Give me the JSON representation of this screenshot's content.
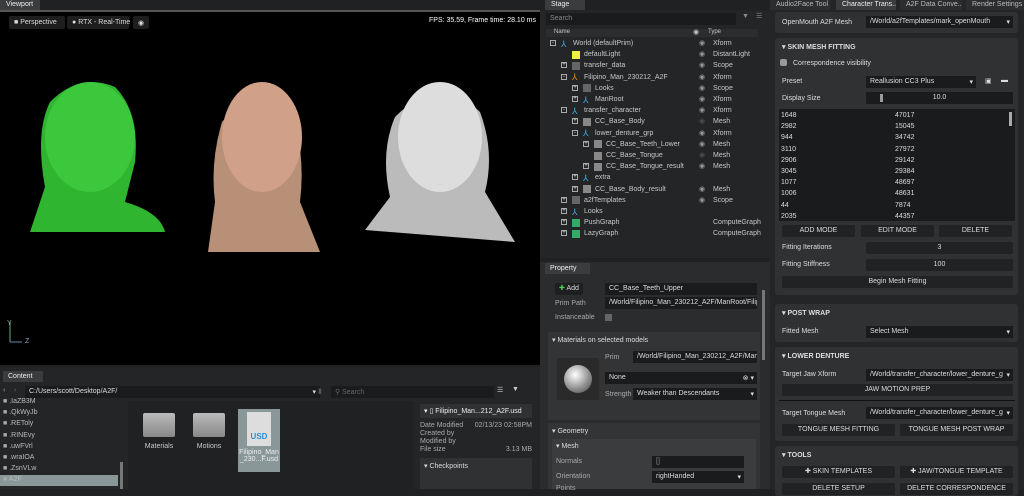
{
  "viewport": {
    "tab": "Viewport",
    "camera": "Perspective",
    "renderer": "RTX - Real-Time",
    "fps": "FPS: 35.59, Frame time: 28.10 ms",
    "axis_y": "Y",
    "axis_z": "Z"
  },
  "stage": {
    "tab": "Stage",
    "search_placeholder": "Search",
    "col_name": "Name",
    "col_type": "Type",
    "rows": [
      {
        "name": "World (defaultPrim)",
        "type": "Xform",
        "depth": 0,
        "exp": "-",
        "icon": "xform"
      },
      {
        "name": "defaultLight",
        "type": "DistantLight",
        "depth": 1,
        "exp": "",
        "icon": "light"
      },
      {
        "name": "transfer_data",
        "type": "Scope",
        "depth": 1,
        "exp": "+",
        "icon": "folder"
      },
      {
        "name": "Filipino_Man_230212_A2F",
        "type": "Xform",
        "depth": 1,
        "exp": "-",
        "icon": "xform-orange"
      },
      {
        "name": "Looks",
        "type": "Scope",
        "depth": 2,
        "exp": "+",
        "icon": "folder"
      },
      {
        "name": "ManRoot",
        "type": "Xform",
        "depth": 2,
        "exp": "+",
        "icon": "xform"
      },
      {
        "name": "transfer_character",
        "type": "Xform",
        "depth": 1,
        "exp": "-",
        "icon": "xform"
      },
      {
        "name": "CC_Base_Body",
        "type": "Mesh",
        "depth": 2,
        "exp": "+",
        "icon": "mesh"
      },
      {
        "name": "lower_denture_grp",
        "type": "Xform",
        "depth": 2,
        "exp": "-",
        "icon": "xform"
      },
      {
        "name": "CC_Base_Teeth_Lower",
        "type": "Mesh",
        "depth": 3,
        "exp": "+",
        "icon": "mesh"
      },
      {
        "name": "CC_Base_Tongue",
        "type": "Mesh",
        "depth": 3,
        "exp": "",
        "icon": "mesh"
      },
      {
        "name": "CC_Base_Tongue_result",
        "type": "Mesh",
        "depth": 3,
        "exp": "+",
        "icon": "mesh"
      },
      {
        "name": "extra",
        "type": "",
        "depth": 2,
        "exp": "+",
        "icon": "xform"
      },
      {
        "name": "CC_Base_Body_result",
        "type": "Mesh",
        "depth": 2,
        "exp": "+",
        "icon": "mesh"
      },
      {
        "name": "a2fTemplates",
        "type": "Scope",
        "depth": 1,
        "exp": "+",
        "icon": "folder"
      },
      {
        "name": "Looks",
        "type": "",
        "depth": 1,
        "exp": "+",
        "icon": "xform"
      },
      {
        "name": "PushGraph",
        "type": "ComputeGraph",
        "depth": 1,
        "exp": "+",
        "icon": "graph"
      },
      {
        "name": "LazyGraph",
        "type": "ComputeGraph",
        "depth": 1,
        "exp": "+",
        "icon": "graph"
      }
    ]
  },
  "property": {
    "tab": "Property",
    "add": "Add",
    "prim_name": "CC_Base_Teeth_Upper",
    "prim_path_label": "Prim Path",
    "prim_path": "/World/Filipino_Man_230212_A2F/ManRoot/Filipino",
    "instanceable_label": "Instanceable",
    "materials_header": "Materials on selected models",
    "prim_label": "Prim",
    "mat_prim": "/World/Filipino_Man_230212_A2F/ManRoot",
    "material": "None",
    "strength_label": "Strength",
    "strength": "Weaker than Descendants",
    "geometry_header": "Geometry",
    "mesh_header": "Mesh",
    "normals_label": "Normals",
    "normals": "[]",
    "orientation_label": "Orientation",
    "orientation": "rightHanded",
    "points_label": "Points"
  },
  "right": {
    "tabs": [
      "Audio2Face Tool",
      "Character Trans...",
      "A2F Data Conve...",
      "Render Settings"
    ],
    "openmouth_label": "OpenMouth A2F Mesh",
    "openmouth": "/World/a2fTemplates/mark_openMouth",
    "skin": {
      "header": "SKIN MESH FITTING",
      "corr": "Correspondence visibility",
      "preset_label": "Preset",
      "preset": "Reallusion CC3 Plus",
      "display_label": "Display Size",
      "display": "10.0",
      "pairs": [
        [
          "1648",
          "47017"
        ],
        [
          "2982",
          "15045"
        ],
        [
          "944",
          "34742"
        ],
        [
          "3110",
          "27972"
        ],
        [
          "2906",
          "29142"
        ],
        [
          "3045",
          "29384"
        ],
        [
          "1077",
          "48697"
        ],
        [
          "1006",
          "48631"
        ],
        [
          "44",
          "7874"
        ],
        [
          "2035",
          "44357"
        ]
      ],
      "add": "ADD MODE",
      "edit": "EDIT MODE",
      "delete": "DELETE",
      "iter_label": "Fitting Iterations",
      "iter": "3",
      "stiff_label": "Fitting Stiffness",
      "stiff": "100",
      "begin": "Begin Mesh Fitting"
    },
    "postwrap": {
      "header": "POST WRAP",
      "fitted_label": "Fitted Mesh",
      "fitted": "Select Mesh"
    },
    "denture": {
      "header": "LOWER DENTURE",
      "jaw_label": "Target Jaw Xform",
      "jaw": "/World/transfer_character/lower_denture_g",
      "jaw_btn": "JAW MOTION PREP",
      "tongue_label": "Target Tongue Mesh",
      "tongue": "/World/transfer_character/lower_denture_g",
      "fit": "TONGUE MESH FITTING",
      "wrap": "TONGUE MESH POST WRAP"
    },
    "tools": {
      "header": "TOOLS",
      "skin": "SKIN TEMPLATES",
      "jaw": "JAW/TONGUE TEMPLATE",
      "del_setup": "DELETE SETUP",
      "del_corr": "DELETE CORRESPONDENCE"
    }
  },
  "content": {
    "tab": "Content",
    "path": "C:/Users/scott/Desktop/A2F/",
    "search_placeholder": "Search",
    "tree": [
      ".IaZB3M",
      ".QkWyJb",
      ".REToly",
      ".RINEvy",
      ".uwFVrl",
      ".wraIOA",
      ".ZsnVLw",
      "A2F"
    ],
    "items": [
      "Materials",
      "Motions",
      "Filipino_Man_230...F.usd"
    ],
    "info": {
      "file": "Filipino_Man...212_A2F.usd",
      "date_label": "Date Modified",
      "date": "02/13/23 02:58PM",
      "created_label": "Created by",
      "modified_label": "Modified by",
      "size_label": "File size",
      "size": "3.13 MB",
      "checkpoints": "Checkpoints"
    }
  },
  "colors": {
    "green_head": "#2fb52f",
    "skin": "#c89a80",
    "accent": "#76b900"
  }
}
